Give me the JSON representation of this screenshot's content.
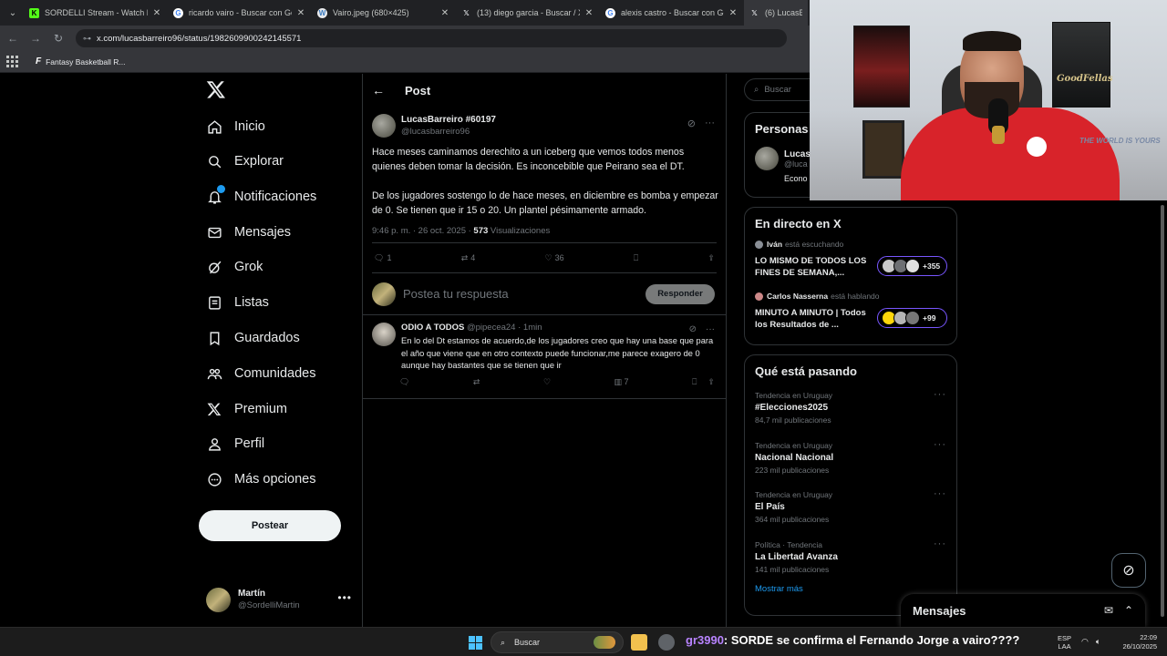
{
  "browser": {
    "tabs": [
      {
        "title": "SORDELLI Stream - Watch Live o",
        "favicon_color": "#53fc18",
        "favicon_glyph": "K"
      },
      {
        "title": "ricardo vairo - Buscar con Goog",
        "favicon_color": "#4285f4",
        "favicon_glyph": "G"
      },
      {
        "title": "Vairo.jpeg (680×425)",
        "favicon_color": "#3b7bbf",
        "favicon_glyph": "W"
      },
      {
        "title": "(13) diego garcia - Buscar / X",
        "favicon_color": "#000000",
        "favicon_glyph": "𝕏"
      },
      {
        "title": "alexis castro - Buscar con Goog",
        "favicon_color": "#4285f4",
        "favicon_glyph": "G"
      },
      {
        "title": "(6) LucasBarr",
        "favicon_color": "#000000",
        "favicon_glyph": "𝕏"
      }
    ],
    "url": "x.com/lucasbarreiro96/status/1982609900242145571",
    "bookmark": "Fantasy Basketball R..."
  },
  "nav": {
    "items": [
      {
        "label": "Inicio",
        "icon": "home-icon"
      },
      {
        "label": "Explorar",
        "icon": "search-icon"
      },
      {
        "label": "Notificaciones",
        "icon": "bell-icon"
      },
      {
        "label": "Mensajes",
        "icon": "mail-icon"
      },
      {
        "label": "Grok",
        "icon": "grok-icon"
      },
      {
        "label": "Listas",
        "icon": "list-icon"
      },
      {
        "label": "Guardados",
        "icon": "bookmark-icon"
      },
      {
        "label": "Comunidades",
        "icon": "communities-icon"
      },
      {
        "label": "Premium",
        "icon": "x-logo-icon"
      },
      {
        "label": "Perfil",
        "icon": "person-icon"
      },
      {
        "label": "Más opciones",
        "icon": "more-circle-icon"
      }
    ],
    "post_button": "Postear",
    "account": {
      "name": "Martín",
      "handle": "@SordelliMartin"
    }
  },
  "post": {
    "header": "Post",
    "author_name": "LucasBarreiro #60197",
    "author_handle": "@lucasbarreiro96",
    "text": "Hace meses caminamos derechito a un iceberg que vemos todos menos quienes deben tomar la decisión. Es inconcebible que Peirano sea el DT.\n\nDe los jugadores sostengo lo de hace meses, en diciembre es bomba y empezar de 0. Se tienen que ir 15 o 20. Un plantel pésimamente armado.",
    "timestamp": "9:46 p. m. · 26 oct. 2025 · ",
    "views": "573",
    "views_label": " Visualizaciones",
    "replies": "1",
    "reposts": "4",
    "likes": "36",
    "reply_placeholder": "Postea tu respuesta",
    "reply_button": "Responder"
  },
  "reply": {
    "name": "ODIO A TODOS",
    "handle": "@pipecea24",
    "time": "· 1min",
    "text": "En lo del Dt estamos de acuerdo,de los jugadores creo que hay una base que para el año que viene que en otro contexto puede funcionar,me parece exagero de 0 aunque hay bastantes que se tienen que ir",
    "views": "7"
  },
  "sidebar": {
    "search_placeholder": "Buscar",
    "people_title": "Personas",
    "person_name": "Lucas",
    "person_handle": "@luca",
    "person_desc": "Econo",
    "live_title": "En directo en X",
    "live": [
      {
        "who": "Iván",
        "status": "está escuchando",
        "title": "LO MISMO DE TODOS LOS FINES DE SEMANA,...",
        "count": "+355"
      },
      {
        "who": "Carlos Nasserna",
        "status": "está hablando",
        "title": "MINUTO A MINUTO | Todos los Resultados de ...",
        "count": "+99"
      }
    ],
    "trends_title": "Qué está pasando",
    "trends": [
      {
        "context": "Tendencia en Uruguay",
        "name": "#Elecciones2025",
        "count": "84,7 mil publicaciones"
      },
      {
        "context": "Tendencia en Uruguay",
        "name": "Nacional Nacional",
        "count": "223 mil publicaciones"
      },
      {
        "context": "Tendencia en Uruguay",
        "name": "El País",
        "count": "364 mil publicaciones"
      },
      {
        "context": "Política · Tendencia",
        "name": "La Libertad Avanza",
        "count": "141 mil publicaciones"
      }
    ],
    "show_more": "Mostrar más"
  },
  "messages_drawer": "Mensajes",
  "webcam": {
    "poster_text": "GoodFellas",
    "wall_text": "THE WORLD IS YOURS"
  },
  "taskbar": {
    "search": "Buscar",
    "ticker_user": "gr3990",
    "ticker_text": ": SORDE se confirma el Fernando Jorge a vairo????",
    "lang1": "ESP",
    "lang2": "LAA",
    "time": "22:09",
    "date": "26/10/2025"
  },
  "colors": {
    "accent": "#1d9bf0",
    "live_border": "#7856ff",
    "background": "#000000"
  }
}
